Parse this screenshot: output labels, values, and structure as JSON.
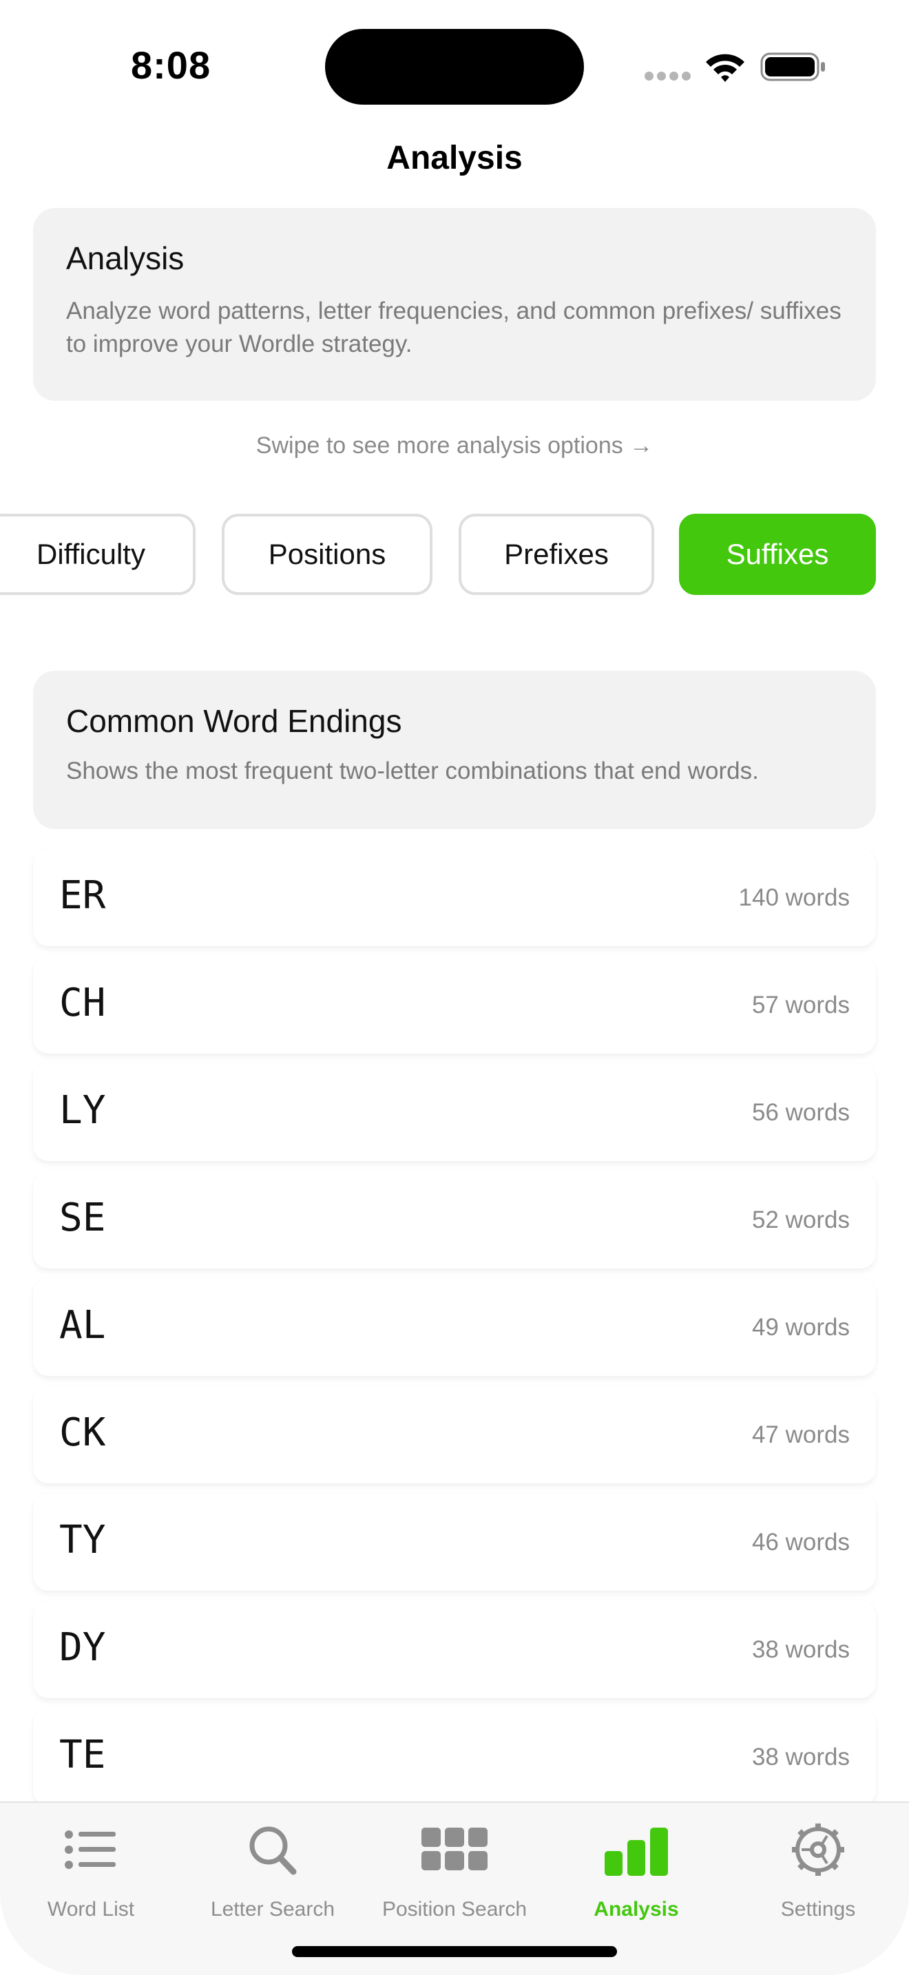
{
  "status_bar": {
    "time": "8:08"
  },
  "nav": {
    "title": "Analysis"
  },
  "intro_card": {
    "title": "Analysis",
    "description": "Analyze word patterns, letter frequencies, and common prefixes/ suffixes to improve your Wordle strategy."
  },
  "swipe_hint": "Swipe to see more analysis options →",
  "segments": {
    "difficulty": "Difficulty",
    "positions": "Positions",
    "prefixes": "Prefixes",
    "suffixes": "Suffixes",
    "active": "Suffixes"
  },
  "section": {
    "title": "Common Word Endings",
    "description": "Shows the most frequent two-letter combinations that end words."
  },
  "suffixes": [
    {
      "suffix": "ER",
      "count": "140 words"
    },
    {
      "suffix": "CH",
      "count": "57 words"
    },
    {
      "suffix": "LY",
      "count": "56 words"
    },
    {
      "suffix": "SE",
      "count": "52 words"
    },
    {
      "suffix": "AL",
      "count": "49 words"
    },
    {
      "suffix": "CK",
      "count": "47 words"
    },
    {
      "suffix": "TY",
      "count": "46 words"
    },
    {
      "suffix": "DY",
      "count": "38 words"
    },
    {
      "suffix": "TE",
      "count": "38 words"
    }
  ],
  "tab_bar": {
    "word_list": "Word List",
    "letter_search": "Letter Search",
    "position_search": "Position Search",
    "analysis": "Analysis",
    "settings": "Settings",
    "active": "Analysis"
  },
  "colors": {
    "accent": "#43c80e",
    "card_bg": "#f2f2f2",
    "secondary_text": "#8a8a8a"
  }
}
